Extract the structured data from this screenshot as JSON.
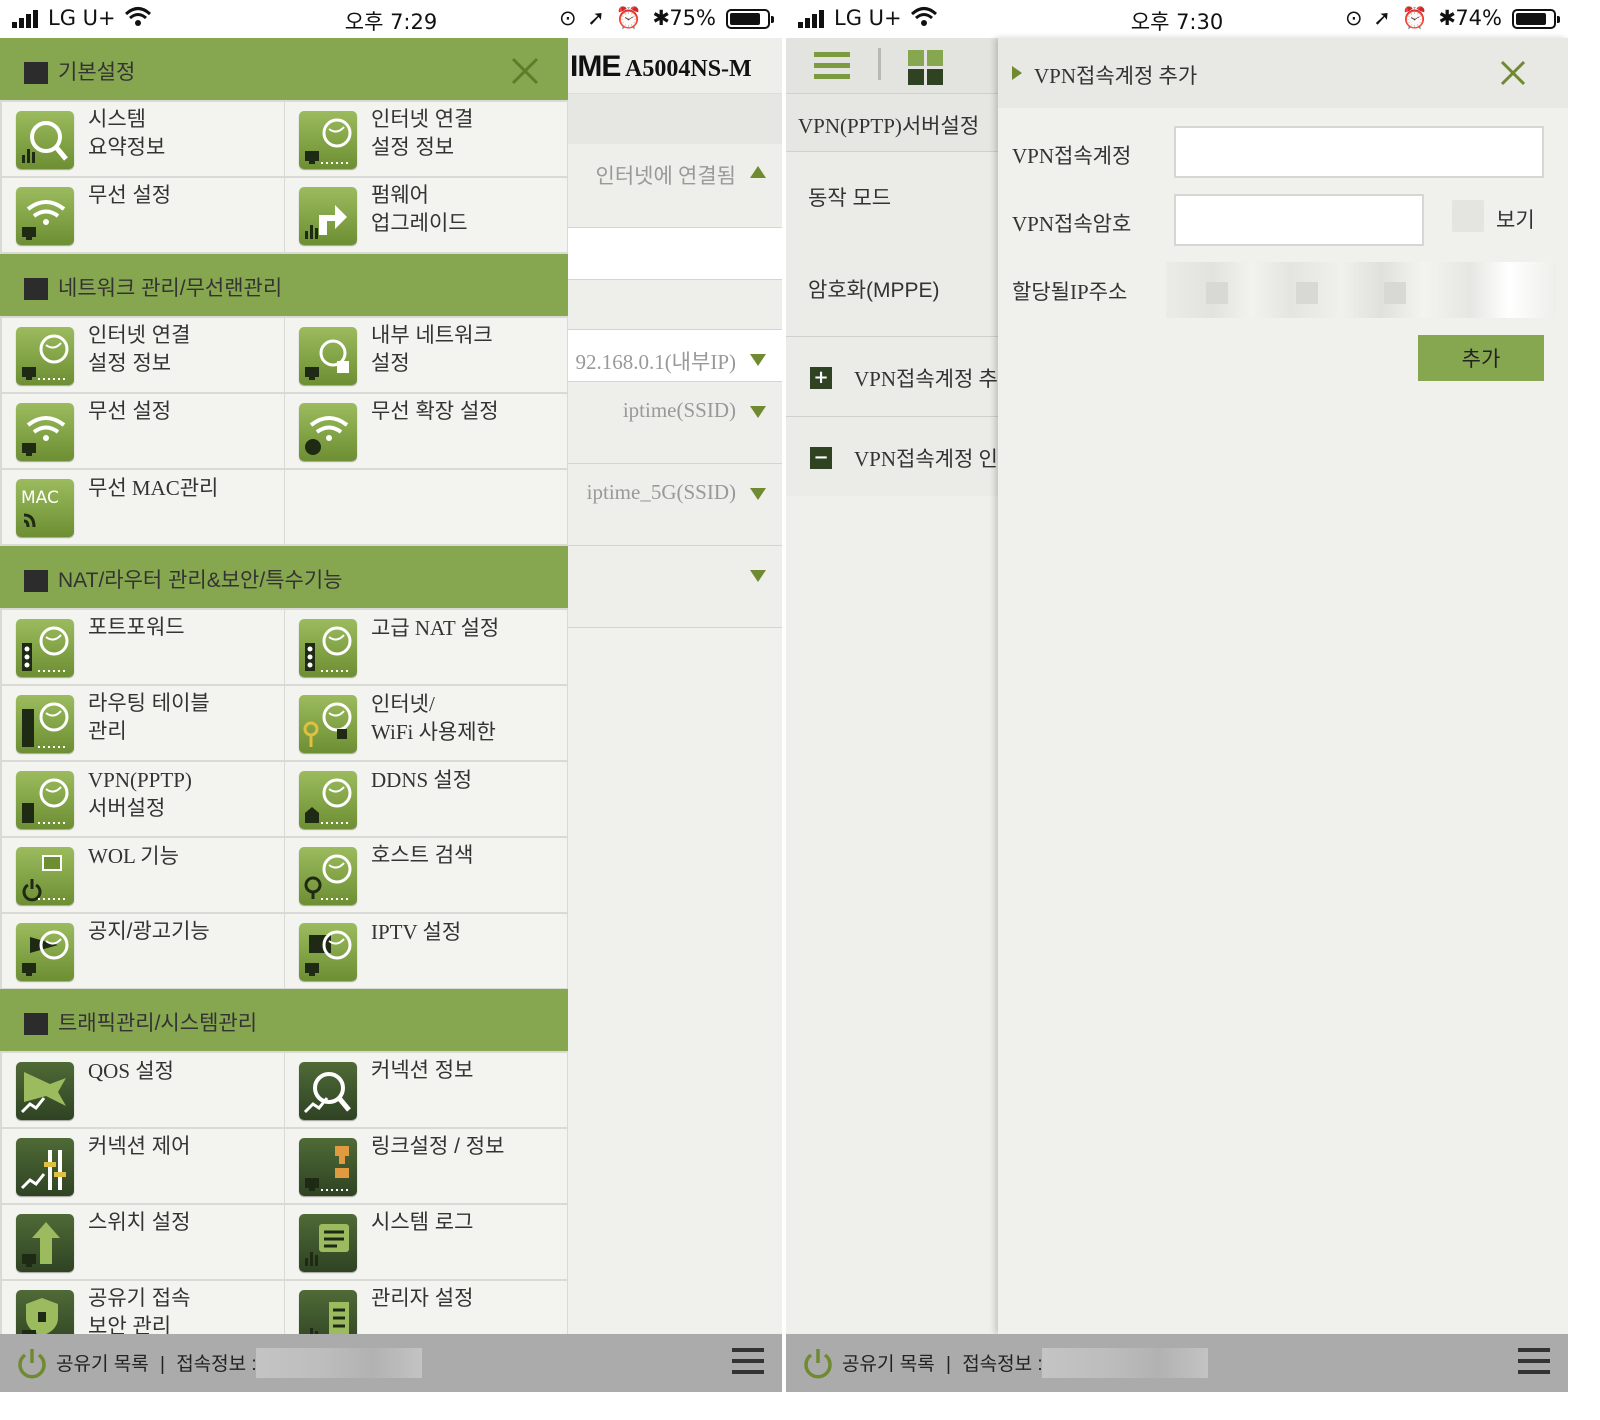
{
  "left_screen": {
    "status": {
      "carrier": "LG U+",
      "time": "오후 7:29",
      "battery": "75%",
      "battery_level": 0.75,
      "indicators": "⊙ ➚ ⏰ ✱"
    },
    "background_page": {
      "logo_brand": "IME",
      "logo_model": "A5004NS-M",
      "rows": [
        {
          "value": "인터넷에 연결됨",
          "arrow": "up"
        },
        {
          "value": ""
        },
        {
          "value": ""
        },
        {
          "value": "92.168.0.1(내부IP)",
          "arrow": "down"
        },
        {
          "value": "iptime(SSID)",
          "arrow": "down"
        },
        {
          "value": "iptime_5G(SSID)",
          "arrow": "down"
        },
        {
          "value": "",
          "arrow": "down"
        }
      ]
    },
    "menu": {
      "sections": [
        {
          "title": "기본설정",
          "items": [
            {
              "label": "시스템\n요약정보",
              "icon": "system-summary-icon"
            },
            {
              "label": "인터넷 연결\n설정 정보",
              "icon": "internet-connection-icon"
            },
            {
              "label": "무선 설정",
              "icon": "wireless-icon"
            },
            {
              "label": "펌웨어\n업그레이드",
              "icon": "firmware-upgrade-icon"
            }
          ]
        },
        {
          "title": "네트워크 관리/무선랜관리",
          "items": [
            {
              "label": "인터넷 연결\n설정 정보",
              "icon": "internet-connection-icon"
            },
            {
              "label": "내부 네트워크\n설정",
              "icon": "internal-network-icon"
            },
            {
              "label": "무선 설정",
              "icon": "wireless-icon"
            },
            {
              "label": "무선 확장 설정",
              "icon": "wireless-extension-icon"
            },
            {
              "label": "무선 MAC관리",
              "icon": "mac-icon"
            }
          ]
        },
        {
          "title": "NAT/라우터 관리&보안/특수기능",
          "items": [
            {
              "label": "포트포워드",
              "icon": "port-forward-icon"
            },
            {
              "label": "고급 NAT 설정",
              "icon": "advanced-nat-icon"
            },
            {
              "label": "라우팅 테이블\n관리",
              "icon": "routing-table-icon"
            },
            {
              "label": "인터넷/\nWiFi 사용제한",
              "icon": "internet-restriction-icon"
            },
            {
              "label": "VPN(PPTP)\n서버설정",
              "icon": "vpn-icon"
            },
            {
              "label": "DDNS 설정",
              "icon": "ddns-icon"
            },
            {
              "label": "WOL 기능",
              "icon": "wol-icon"
            },
            {
              "label": "호스트 검색",
              "icon": "host-search-icon"
            },
            {
              "label": "공지/광고기능",
              "icon": "notice-icon"
            },
            {
              "label": "IPTV 설정",
              "icon": "iptv-icon"
            }
          ]
        },
        {
          "title": "트래픽관리/시스템관리",
          "items": [
            {
              "label": "QOS 설정",
              "icon": "qos-icon"
            },
            {
              "label": "커넥션 정보",
              "icon": "connection-info-icon"
            },
            {
              "label": "커넥션 제어",
              "icon": "connection-control-icon"
            },
            {
              "label": "링크설정 / 정보",
              "icon": "link-settings-icon"
            },
            {
              "label": "스위치 설정",
              "icon": "switch-settings-icon"
            },
            {
              "label": "시스템 로그",
              "icon": "system-log-icon"
            },
            {
              "label": "공유기 접속\n보안 관리",
              "icon": "access-security-icon"
            },
            {
              "label": "관리자 설정",
              "icon": "admin-settings-icon"
            }
          ]
        }
      ],
      "icon_text_mac": "MAC"
    },
    "bottom_bar": {
      "router_list": "공유기 목록",
      "separator": "|",
      "access_info": "접속정보 :"
    }
  },
  "right_screen": {
    "status": {
      "carrier": "LG U+",
      "time": "오후 7:30",
      "battery": "74%",
      "battery_level": 0.74,
      "indicators": "⊙ ➚ ⏰ ✱"
    },
    "nav": {
      "title": "VPN(PPTP)서버설정",
      "items": [
        "동작 모드",
        "암호화(MPPE)"
      ],
      "sub_items": [
        {
          "sign": "+",
          "label": "VPN접속계정 추가"
        },
        {
          "sign": "−",
          "label": "VPN접속계정 인"
        }
      ]
    },
    "dialog": {
      "title": "VPN접속계정 추가",
      "account_label": "VPN접속계정",
      "account_value": "",
      "password_label": "VPN접속암호",
      "password_value": "",
      "show_label": "보기",
      "ip_label": "할당될IP주소",
      "add_button": "추가"
    },
    "bottom_bar": {
      "router_list": "공유기 목록",
      "separator": "|",
      "access_info": "접속정보 :"
    }
  },
  "colors": {
    "accent_green": "#87a650",
    "dark_green": "#2f4323",
    "menu_bg": "#f3f3ef"
  }
}
